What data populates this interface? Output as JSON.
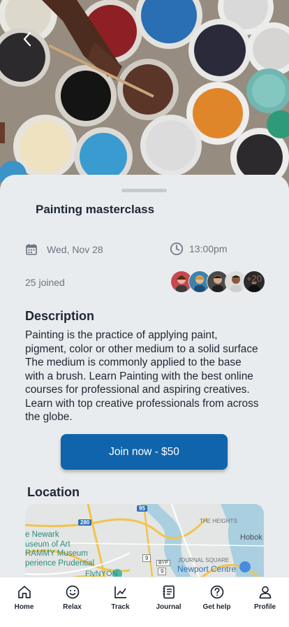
{
  "header": {
    "back_icon": "chevron-left-icon"
  },
  "event": {
    "title": "Painting masterclass",
    "date": "Wed, Nov 28",
    "time": "13:00pm",
    "joined": "25 joined",
    "extra_count": "+20",
    "description_heading": "Description",
    "description": "Painting is the practice of applying paint, pigment, color or other medium to a solid surface The medium is commonly applied to the base with a brush. Learn Painting with the best online courses for professional and aspiring creatives. Learn with top creative professionals from across the globe.",
    "join_label": "Join now - $50",
    "location_heading": "Location"
  },
  "map": {
    "labels": {
      "newark": "e Newark",
      "museum": "useum of Art",
      "grammy": "RAMMY Museum",
      "prudential": "perience Prudential",
      "heights": "THE HEIGHTS",
      "hoboken": "Hobok",
      "journal": "JOURNAL SQUARE",
      "newport": "Newport Centre",
      "fly": "FlyNYON",
      "r95": "95",
      "r280": "280",
      "r9": "9",
      "r9b": "9",
      "byp": "BYP"
    }
  },
  "nav": [
    {
      "label": "Home",
      "icon": "home-icon"
    },
    {
      "label": "Relax",
      "icon": "smile-icon"
    },
    {
      "label": "Track",
      "icon": "chart-line-icon"
    },
    {
      "label": "Journal",
      "icon": "journal-icon"
    },
    {
      "label": "Get help",
      "icon": "help-circle-icon"
    },
    {
      "label": "Profile",
      "icon": "user-icon"
    }
  ]
}
